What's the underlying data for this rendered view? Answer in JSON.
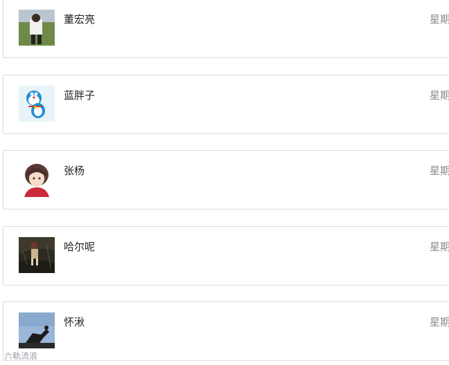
{
  "chat_list": {
    "items": [
      {
        "name": "董宏亮",
        "time": "星期",
        "avatar": "avatar-photo-man-outdoors"
      },
      {
        "name": "蓝胖子",
        "time": "星期",
        "avatar": "avatar-doraemon"
      },
      {
        "name": "张杨",
        "time": "星期",
        "avatar": "avatar-anime-boy"
      },
      {
        "name": "哈尔呢",
        "time": "星期",
        "avatar": "avatar-dark-anime-scene"
      },
      {
        "name": "怀湫",
        "time": "星期",
        "avatar": "avatar-silhouette-sky"
      }
    ]
  },
  "watermark": {
    "text": "六軌流浪"
  }
}
